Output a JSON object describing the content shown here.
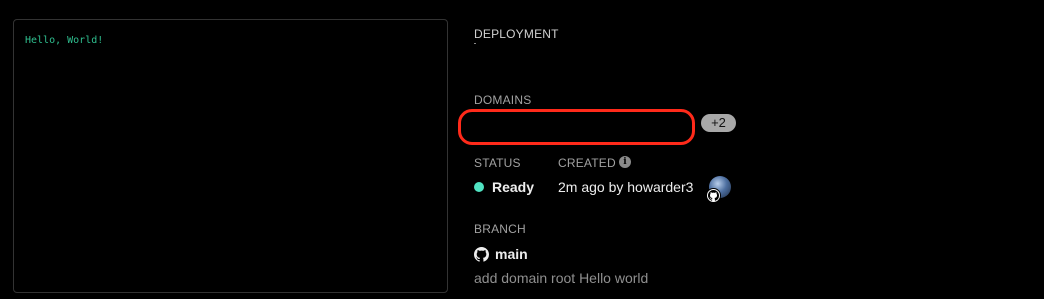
{
  "preview": {
    "text": "Hello, World!"
  },
  "deployment": {
    "label": "DEPLOYMENT"
  },
  "domains": {
    "label": "DOMAINS",
    "more_badge": "+2"
  },
  "status": {
    "label": "STATUS",
    "value": "Ready",
    "color": "#50e3c2"
  },
  "created": {
    "label": "CREATED",
    "value": "2m ago by howarder3",
    "info_icon": "info-icon"
  },
  "branch": {
    "label": "BRANCH",
    "name": "main",
    "icon": "github-icon",
    "commit_message": "add domain root Hello world"
  },
  "highlight": {
    "color": "#ff2a1a"
  }
}
